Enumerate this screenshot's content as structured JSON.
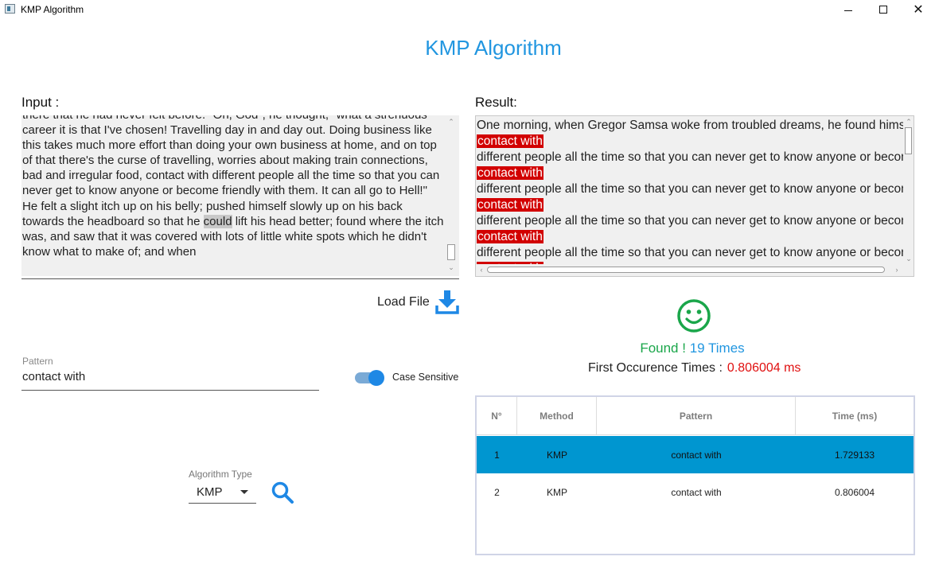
{
  "window": {
    "title": "KMP Algorithm",
    "minimize": "—",
    "close": "✕"
  },
  "heading": "KMP Algorithm",
  "input": {
    "label": "Input :",
    "text_before": "there that he had never felt before. \"Oh, God\", he thought, \"what a strenuous career it is that I've chosen! Travelling day in and day out. Doing business like this takes much more effort than doing your own business at home, and on top of that there's the curse of travelling, worries about making train connections, bad and irregular food, contact with different people all the time so that you can never get to know anyone or become friendly with them. It can all go to Hell!\" He felt a slight itch up on his belly; pushed himself slowly up on his back towards the headboard so that he ",
    "text_highlight": "could",
    "text_after": " lift his head better; found where the itch was, and saw that it was covered with lots of little white spots which he didn't know what to make of; and when"
  },
  "result": {
    "label": "Result:",
    "first_line": "One morning, when Gregor Samsa woke from troubled dreams, he found himself",
    "match_text": "contact with",
    "repeat_line": " different people all the time so that you can never get to know anyone or become friendly"
  },
  "load_file": {
    "label": "Load File",
    "icon": "download-icon"
  },
  "status": {
    "found_prefix": "Found !",
    "found_count": "19 Times",
    "first_occ_label": "First Occurence Times :",
    "first_occ_value": "0.806004 ms",
    "colors": {
      "found": "#1aa64a",
      "count": "#2196e0",
      "time": "#e01010"
    }
  },
  "pattern": {
    "caption": "Pattern",
    "value": "contact with"
  },
  "case_sensitive": {
    "label": "Case Sensitive",
    "on": true
  },
  "algorithm": {
    "caption": "Algorithm Type",
    "value": "KMP"
  },
  "table": {
    "headers": [
      "N°",
      "Method",
      "Pattern",
      "Time (ms)"
    ],
    "rows": [
      {
        "n": "1",
        "method": "KMP",
        "pattern": "contact with",
        "time": "1.729133",
        "selected": true
      },
      {
        "n": "2",
        "method": "KMP",
        "pattern": "contact with",
        "time": "0.806004",
        "selected": false
      }
    ]
  }
}
